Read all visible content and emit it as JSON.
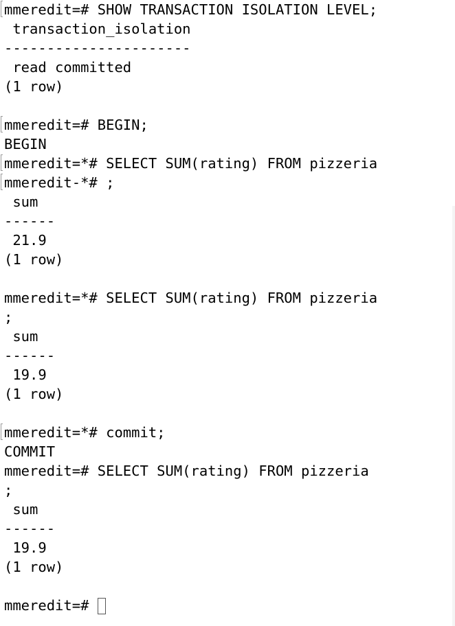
{
  "terminal": {
    "lines": [
      {
        "text": "mmeredit=# SHOW TRANSACTION ISOLATION LEVEL;",
        "marked": true
      },
      {
        "text": " transaction_isolation",
        "marked": false
      },
      {
        "text": "----------------------",
        "marked": false
      },
      {
        "text": " read committed",
        "marked": false
      },
      {
        "text": "(1 row)",
        "marked": false
      },
      {
        "text": "",
        "marked": false
      },
      {
        "text": "mmeredit=# BEGIN;",
        "marked": true
      },
      {
        "text": "BEGIN",
        "marked": false
      },
      {
        "text": "mmeredit=*# SELECT SUM(rating) FROM pizzeria",
        "marked": true
      },
      {
        "text": "mmeredit-*# ;",
        "marked": true
      },
      {
        "text": " sum",
        "marked": false
      },
      {
        "text": "------",
        "marked": false
      },
      {
        "text": " 21.9",
        "marked": false
      },
      {
        "text": "(1 row)",
        "marked": false
      },
      {
        "text": "",
        "marked": false
      },
      {
        "text": "mmeredit=*# SELECT SUM(rating) FROM pizzeria",
        "marked": false
      },
      {
        "text": ";",
        "marked": false
      },
      {
        "text": " sum",
        "marked": false
      },
      {
        "text": "------",
        "marked": false
      },
      {
        "text": " 19.9",
        "marked": false
      },
      {
        "text": "(1 row)",
        "marked": false
      },
      {
        "text": "",
        "marked": false
      },
      {
        "text": "mmeredit=*# commit;",
        "marked": true
      },
      {
        "text": "COMMIT",
        "marked": false
      },
      {
        "text": "mmeredit=# SELECT SUM(rating) FROM pizzeria",
        "marked": false
      },
      {
        "text": ";",
        "marked": false
      },
      {
        "text": " sum",
        "marked": false
      },
      {
        "text": "------",
        "marked": false
      },
      {
        "text": " 19.9",
        "marked": false
      },
      {
        "text": "(1 row)",
        "marked": false
      },
      {
        "text": "",
        "marked": false
      }
    ],
    "prompt": "mmeredit=# "
  }
}
